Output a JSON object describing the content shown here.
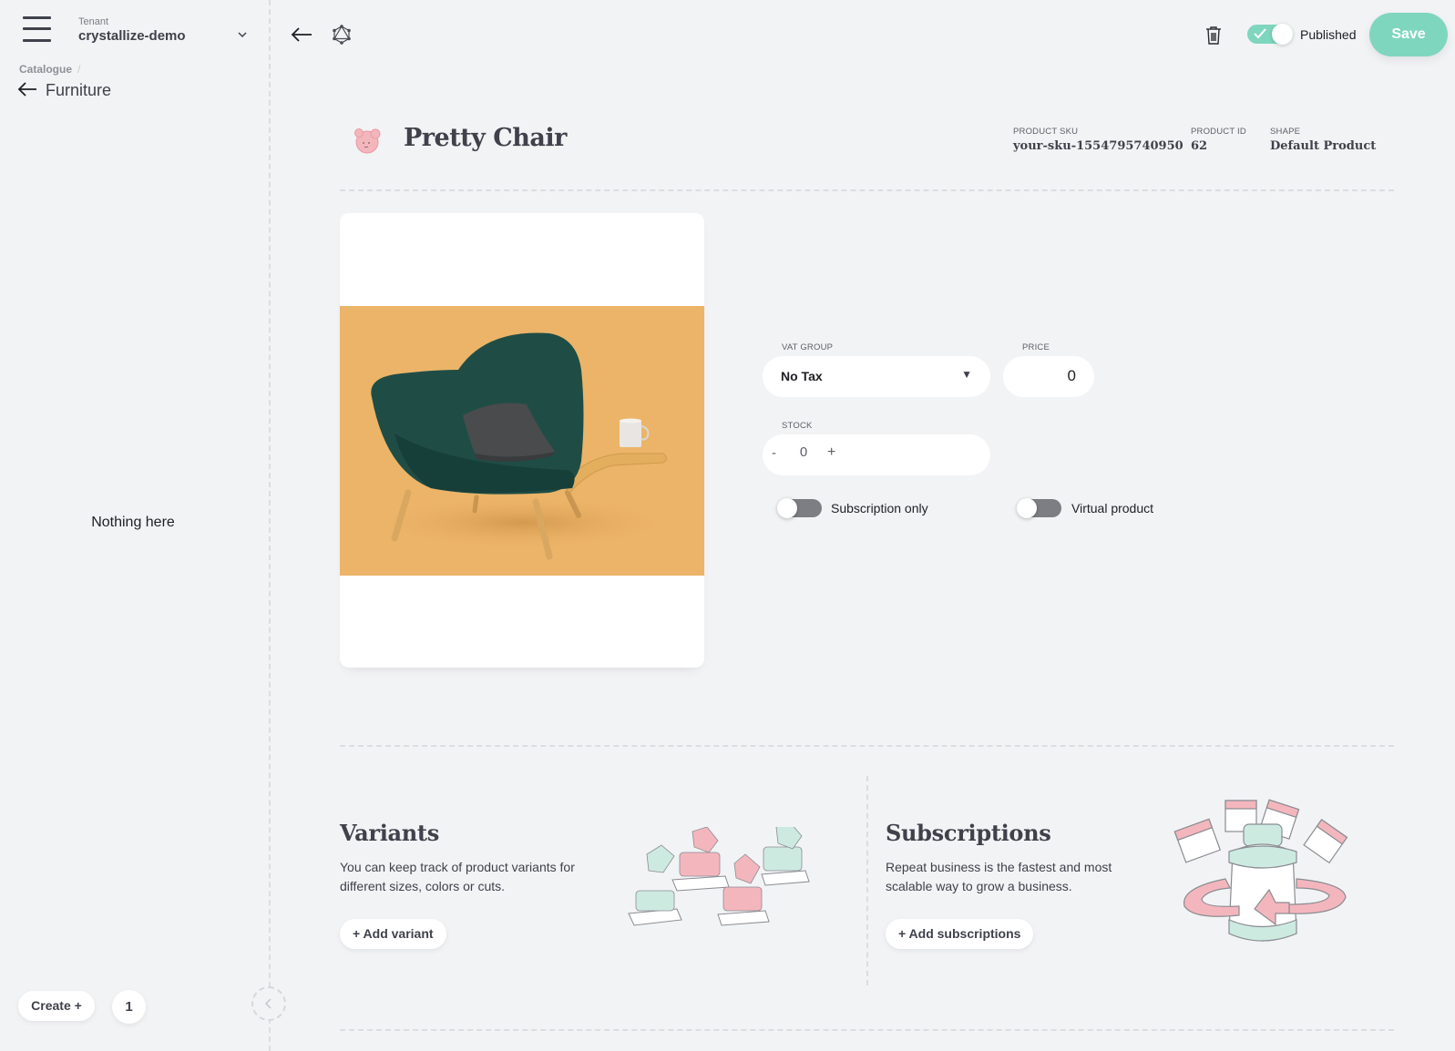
{
  "sidebar": {
    "tenant_label": "Tenant",
    "tenant_name": "crystallize-demo",
    "breadcrumb_root": "Catalogue",
    "breadcrumb_sep": "/",
    "folder_name": "Furniture",
    "empty_message": "Nothing here",
    "create_label": "Create +",
    "count": "1"
  },
  "topbar": {
    "published_label": "Published",
    "published": true,
    "save_label": "Save"
  },
  "product": {
    "title": "Pretty Chair",
    "sku_label": "Product SKU",
    "sku": "your-sku-1554795740950",
    "id_label": "Product ID",
    "id": "62",
    "shape_label": "Shape",
    "shape": "Default Product"
  },
  "form": {
    "vat_label": "VAT Group",
    "vat_value": "No Tax",
    "vat_arrow": "▼",
    "price_label": "Price",
    "price_value": "0",
    "stock_label": "Stock",
    "stock_minus": "-",
    "stock_value": "0",
    "stock_plus": "+",
    "subscription_only_label": "Subscription only",
    "subscription_only": false,
    "virtual_product_label": "Virtual product",
    "virtual_product": false
  },
  "variants": {
    "title": "Variants",
    "description": "You can keep track of product variants for different sizes, colors or cuts.",
    "button": "+ Add variant"
  },
  "subscriptions": {
    "title": "Subscriptions",
    "description": "Repeat business is the fastest and most scalable way to grow a business.",
    "button": "+ Add subscriptions"
  },
  "colors": {
    "accent": "#7fd6bf",
    "background": "#f2f3f5",
    "text": "#3f414b",
    "photo_bg": "#ecb468",
    "pink": "#f4b6bd",
    "mint": "#cdeae1"
  }
}
